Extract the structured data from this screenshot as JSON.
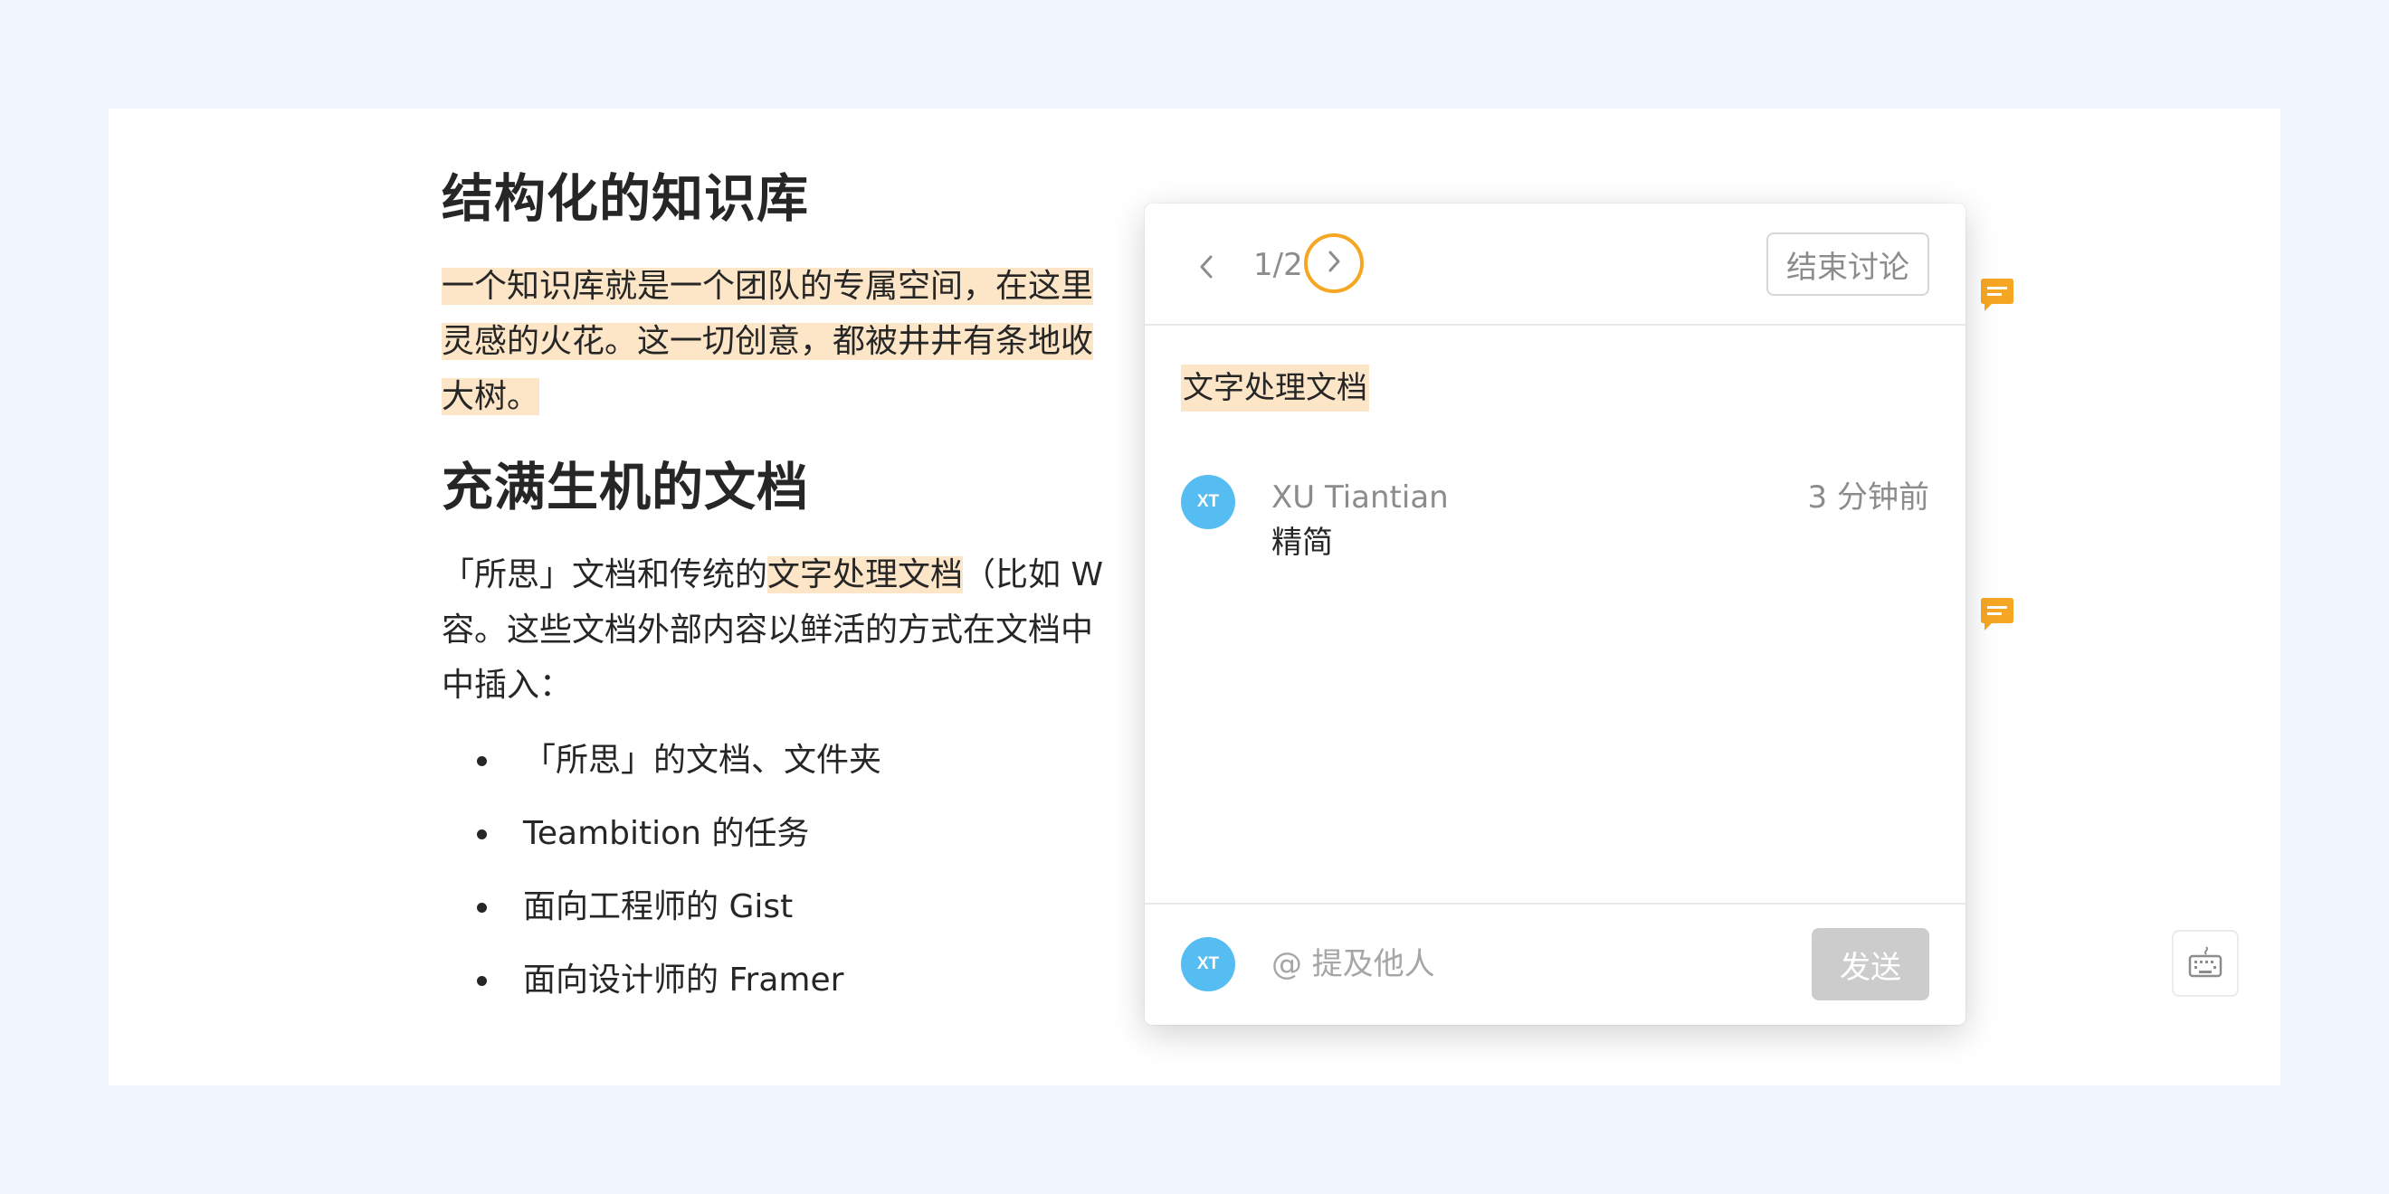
{
  "document": {
    "heading1": "结构化的知识库",
    "para1": {
      "line1": "一个知识库就是一个团队的专属空间，在这里",
      "line2": "灵感的火花。这一切创意，都被井井有条地收",
      "line3": "大树。"
    },
    "heading2": "充满生机的文档",
    "para2": {
      "line1_pre": "「所思」文档和传统的",
      "line1_hl": "文字处理文档",
      "line1_post": "（比如 W",
      "line2": "容。这些文档外部内容以鲜活的方式在文档中",
      "line3": "中插入："
    },
    "list": [
      "「所思」的文档、文件夹",
      "Teambition 的任务",
      "面向工程师的 Gist",
      "面向设计师的 Framer"
    ]
  },
  "popover": {
    "page_indicator": "1/2",
    "end_discussion_label": "结束讨论",
    "quote": "文字处理文档",
    "comment": {
      "avatar_initials": "XT",
      "author": "XU Tiantian",
      "time": "3 分钟前",
      "text": "精简"
    },
    "footer": {
      "avatar_initials": "XT",
      "input_placeholder": "@ 提及他人",
      "send_label": "发送"
    }
  },
  "colors": {
    "background": "#f0f5fe",
    "highlight": "#fde6c8",
    "accent": "#f5a623",
    "avatar": "#56bdf3",
    "send_disabled": "#cccccc"
  },
  "icons": {
    "comment_marker": "comment-icon",
    "prev": "chevron-left-icon",
    "next": "chevron-right-icon",
    "keyboard": "keyboard-icon"
  }
}
